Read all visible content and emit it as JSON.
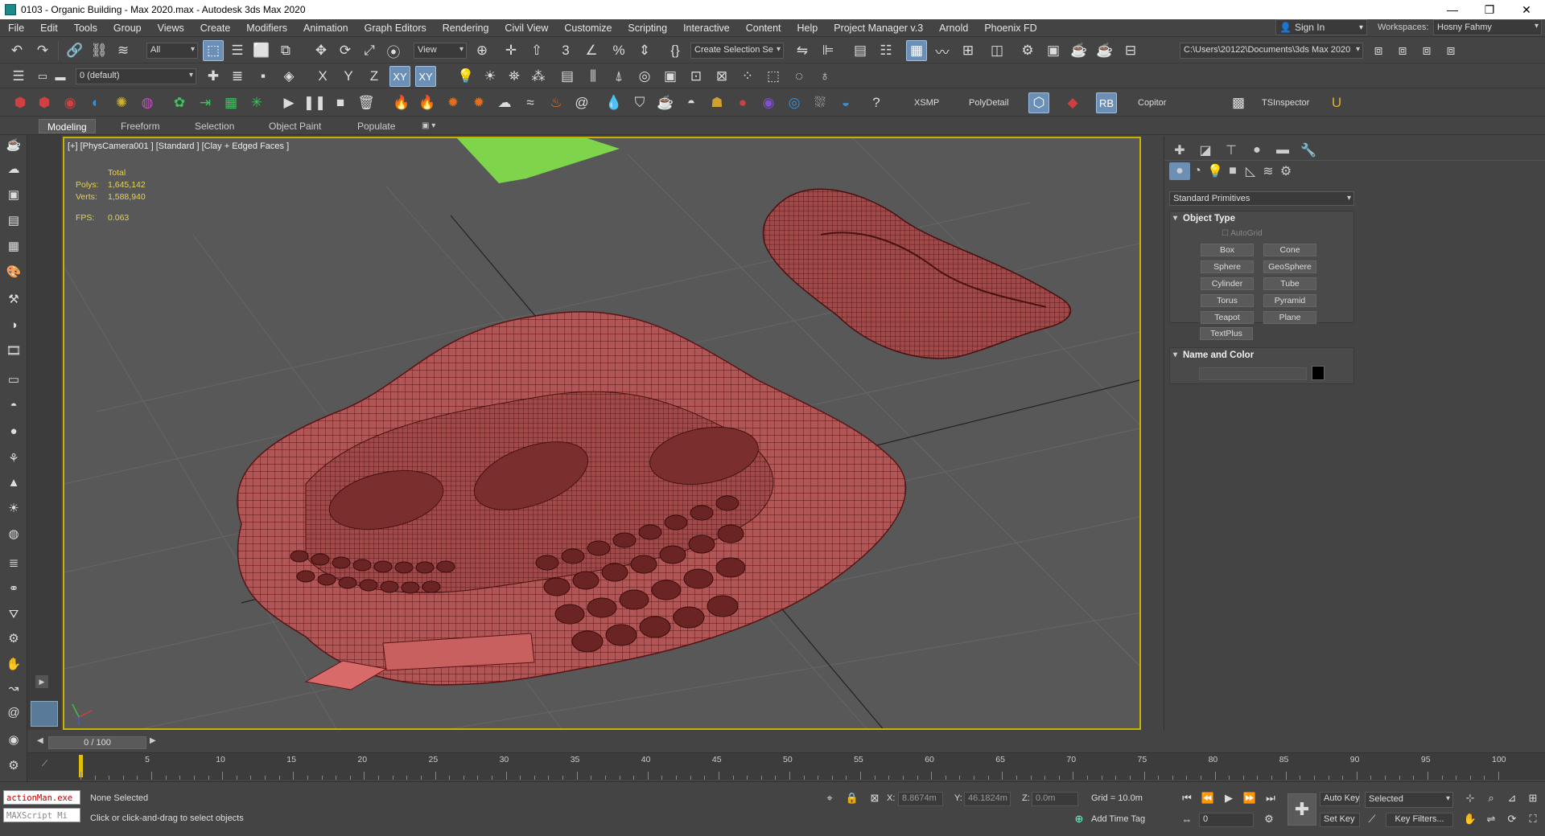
{
  "window": {
    "title": "0103 - Organic Building - Max 2020.max - Autodesk 3ds Max 2020"
  },
  "menu": [
    "File",
    "Edit",
    "Tools",
    "Group",
    "Views",
    "Create",
    "Modifiers",
    "Animation",
    "Graph Editors",
    "Rendering",
    "Civil View",
    "Customize",
    "Scripting",
    "Interactive",
    "Content",
    "Help",
    "Project Manager v.3",
    "Arnold",
    "Phoenix FD"
  ],
  "account": {
    "signin": "Sign In",
    "workspaces_label": "Workspaces:",
    "workspace": "Hosny Fahmy"
  },
  "toolbar1": {
    "selection_filter": "All",
    "ref_coord": "View",
    "selection_set": "Create Selection Se",
    "project_path": "C:\\Users\\20122\\Documents\\3ds Max 2020"
  },
  "toolbar2": {
    "layer": "0 (default)",
    "axis_x": "X",
    "axis_y": "Y",
    "axis_z": "Z",
    "axis_xy": "XY",
    "axis_xy2": "XY"
  },
  "toolbar3": {
    "xsmp": "XSMP",
    "polydetail": "PolyDetail",
    "rb": "RB",
    "copitor": "Copitor",
    "tsinspector": "TSInspector"
  },
  "ribbon": {
    "tabs": [
      "Modeling",
      "Freeform",
      "Selection",
      "Object Paint",
      "Populate"
    ],
    "active": "Modeling"
  },
  "viewport": {
    "label": "[+] [PhysCamera001 ] [Standard ] [Clay + Edged Faces ]",
    "stats": {
      "total_label": "Total",
      "polys_label": "Polys:",
      "polys": "1,645,142",
      "verts_label": "Verts:",
      "verts": "1,588,940",
      "fps_label": "FPS:",
      "fps": "0.063"
    }
  },
  "command_panel": {
    "category": "Standard Primitives",
    "object_type": {
      "title": "Object Type",
      "autogrid": "AutoGrid",
      "buttons": [
        "Box",
        "Cone",
        "Sphere",
        "GeoSphere",
        "Cylinder",
        "Tube",
        "Torus",
        "Pyramid",
        "Teapot",
        "Plane",
        "TextPlus"
      ]
    },
    "name_and_color": {
      "title": "Name and Color",
      "name_value": "",
      "color": "#000000"
    }
  },
  "timeline": {
    "frame_display": "0 / 100",
    "ticks": [
      "0",
      "5",
      "10",
      "15",
      "20",
      "25",
      "30",
      "35",
      "40",
      "45",
      "50",
      "55",
      "60",
      "65",
      "70",
      "75",
      "80",
      "85",
      "90",
      "95",
      "100"
    ]
  },
  "status": {
    "maxscript1": "actionMan.exe",
    "maxscript2": "MAXScript Mi",
    "selection": "None Selected",
    "prompt": "Click or click-and-drag to select objects",
    "x_label": "X:",
    "x_value": "8.8674m",
    "y_label": "Y:",
    "y_value": "46.1824m",
    "z_label": "Z:",
    "z_value": "0.0m",
    "grid": "Grid = 10.0m",
    "add_time_tag": "Add Time Tag",
    "auto_key": "Auto Key",
    "key_mode": "Selected",
    "set_key": "Set Key",
    "key_filters": "Key Filters...",
    "current_frame": "0"
  },
  "colors": {
    "viewport_border": "#c8b400",
    "mesh": "#a94a4a",
    "mesh_wire": "#5a1414",
    "green_plane": "#7ed44a",
    "stats_text": "#e8d34a"
  }
}
